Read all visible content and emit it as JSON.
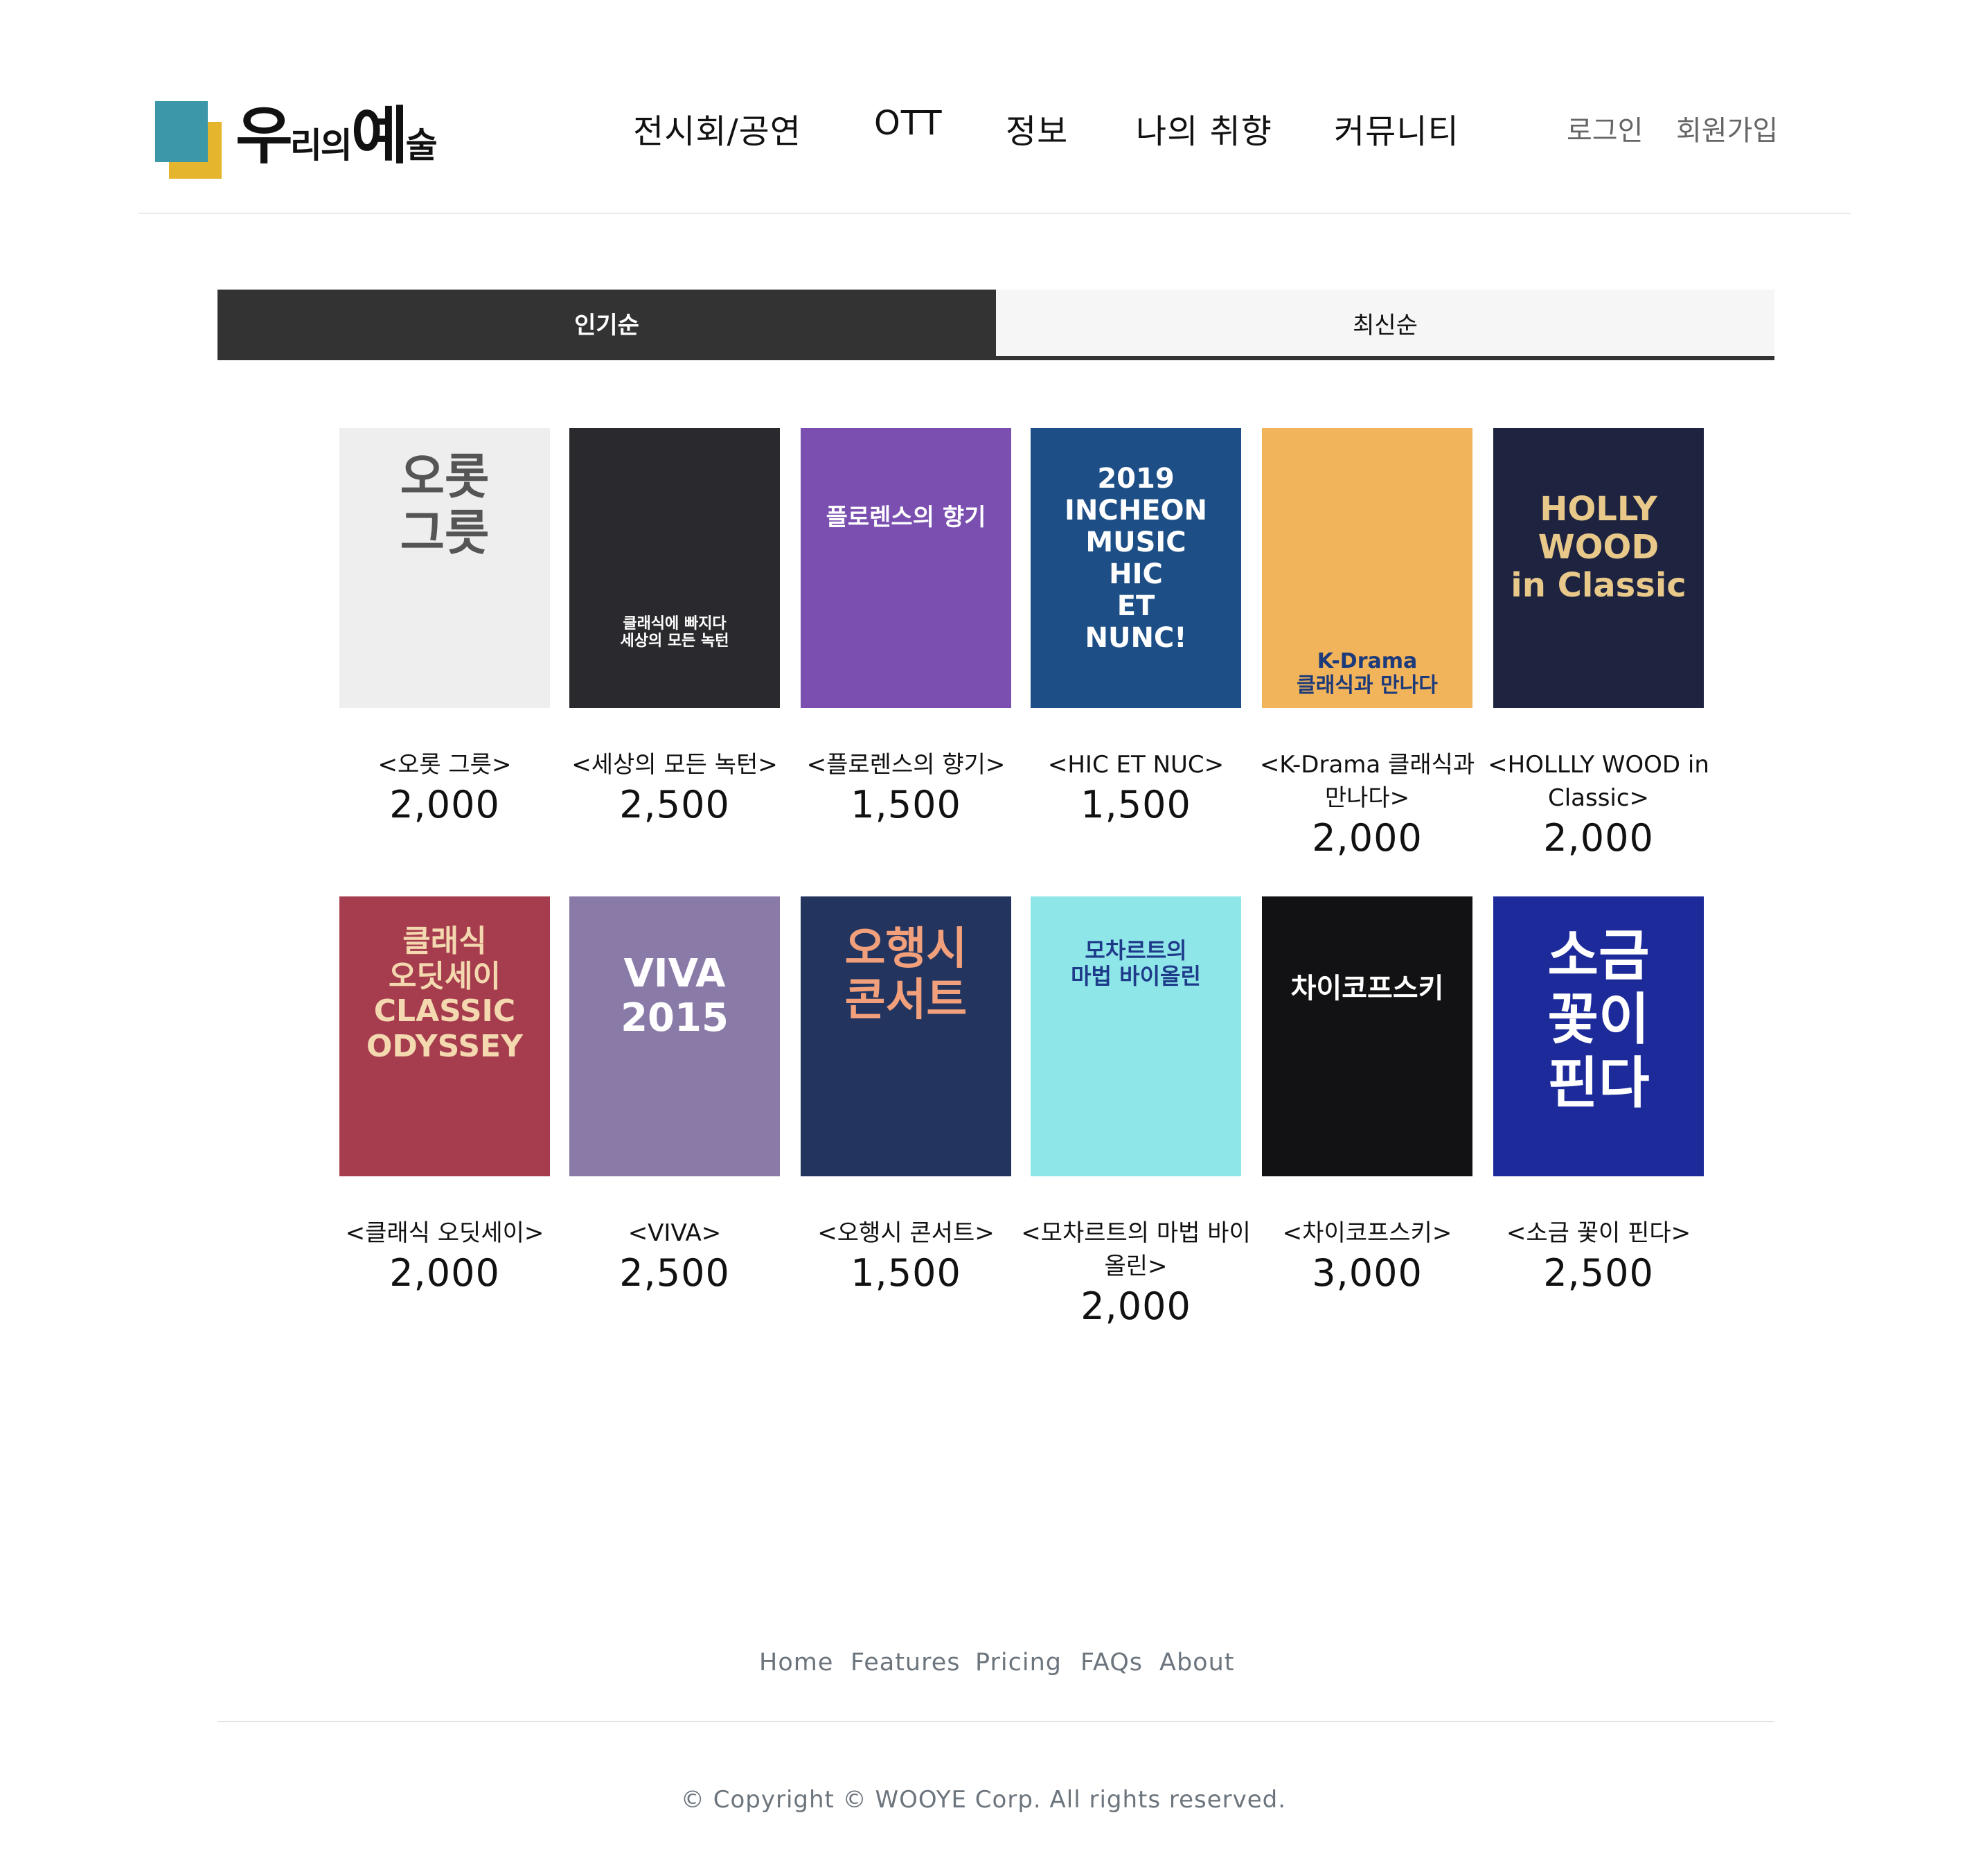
{
  "header": {
    "logo": {
      "part1": "우",
      "part2": "리의",
      "part3": "예",
      "part4": "술"
    },
    "nav": [
      "전시회/공연",
      "OTT",
      "정보",
      "나의 취향",
      "커뮤니티"
    ],
    "auth": {
      "login": "로그인",
      "signup": "회원가입"
    }
  },
  "sort_tabs": {
    "popular": "인기순",
    "latest": "최신순",
    "active": "인기순"
  },
  "items": [
    {
      "title": "<오롯 그릇>",
      "price": "2,000",
      "poster": {
        "bg": "#eeeeee",
        "text": "오롯\n그릇",
        "fg": "#555555"
      }
    },
    {
      "title": "<세상의 모든 녹턴>",
      "price": "2,500",
      "poster": {
        "bg": "#2a2a2e",
        "text": "클래식에 빠지다\n세상의 모든 녹턴",
        "fg": "#ffffff"
      }
    },
    {
      "title": "<플로렌스의 향기>",
      "price": "1,500",
      "poster": {
        "bg": "#7a4fb0",
        "text": "플로렌스의 향기",
        "fg": "#ffffff"
      }
    },
    {
      "title": "<HIC ET NUC>",
      "price": "1,500",
      "poster": {
        "bg": "#1d4f86",
        "text": "2019 INCHEON MUSIC\nHIC\nET\nNUNC!",
        "fg": "#ffffff"
      }
    },
    {
      "title": "<K-Drama 클래식과 만나다>",
      "price": "2,000",
      "poster": {
        "bg": "#f2b45a",
        "text": "K-Drama\n클래식과 만나다",
        "fg": "#1d3b7a"
      }
    },
    {
      "title": "<HOLLLY WOOD in Classic>",
      "price": "2,000",
      "poster": {
        "bg": "#1e2340",
        "text": "HOLLY\nWOOD\nin Classic",
        "fg": "#e9c98a"
      }
    },
    {
      "title": "<클래식 오딧세이>",
      "price": "2,000",
      "poster": {
        "bg": "#a63d4e",
        "text": "클래식\n오딧세이\nCLASSIC\nODYSSEY",
        "fg": "#f4d9b0"
      }
    },
    {
      "title": "<VIVA>",
      "price": "2,500",
      "poster": {
        "bg": "#8a7aa8",
        "text": "VIVA\n2015",
        "fg": "#ffffff"
      }
    },
    {
      "title": "<오행시 콘서트>",
      "price": "1,500",
      "poster": {
        "bg": "#23345e",
        "text": "오행시\n콘서트",
        "fg": "#f2a07b"
      }
    },
    {
      "title": "<모차르트의 마법 바이올린>",
      "price": "2,000",
      "poster": {
        "bg": "#8fe6e8",
        "text": "모차르트의\n마법 바이올린",
        "fg": "#1e3b8a"
      }
    },
    {
      "title": "<차이코프스키>",
      "price": "3,000",
      "poster": {
        "bg": "#121214",
        "text": "차이코프스키",
        "fg": "#ffffff"
      }
    },
    {
      "title": "<소금 꽃이 핀다>",
      "price": "2,500",
      "poster": {
        "bg": "#1c2a9a",
        "text": "소금\n꽃이\n핀다",
        "fg": "#ffffff"
      }
    }
  ],
  "footer": {
    "links": [
      "Home",
      "Features",
      "Pricing",
      "FAQs",
      "About"
    ],
    "copyright": "© Copyright © WOOYE Corp. All rights reserved."
  }
}
